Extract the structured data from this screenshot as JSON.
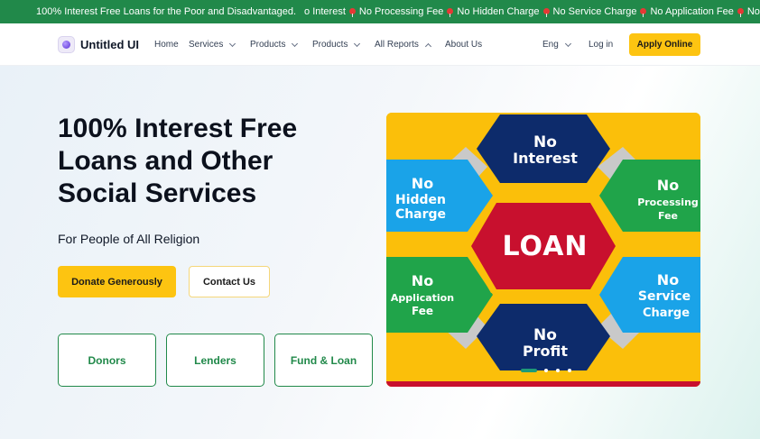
{
  "ticker": {
    "items": [
      "100% Interest Free Loans for the Poor and Disadvantaged.",
      "o Interest",
      "No Processing Fee",
      "No Hidden Charge",
      "No Service Charge",
      "No Application Fee",
      "No Profit."
    ]
  },
  "nav": {
    "logo_text": "Untitled UI",
    "links": [
      "Home",
      "Services",
      "Products",
      "Products",
      "All Reports",
      "About Us"
    ],
    "language": "Eng",
    "login": "Log in",
    "apply": "Apply Online"
  },
  "hero": {
    "title": "100% Interest Free Loans and Other Social Services",
    "subtitle": "For People of All Religion",
    "donate_button": "Donate Generously",
    "contact_button": "Contact Us",
    "cards": [
      "Donors",
      "Lenders",
      "Fund & Loan"
    ]
  },
  "banner": {
    "center": "LOAN",
    "top": [
      "No",
      "Interest"
    ],
    "left_top": [
      "No",
      "Hidden",
      "Charge"
    ],
    "right_top": [
      "No",
      "Processing",
      "Fee"
    ],
    "left_bottom": [
      "No",
      "Application",
      "Fee"
    ],
    "right_bottom": [
      "No",
      "Service",
      "Charge"
    ],
    "bottom": [
      "No",
      "Profit"
    ]
  },
  "colors": {
    "brand_green": "#21894a",
    "accent_yellow": "#fdc411",
    "loan_red": "#c8102e",
    "hex_navy": "#0d2b6b",
    "hex_blue": "#1aa3e8",
    "hex_green": "#20a44a"
  }
}
